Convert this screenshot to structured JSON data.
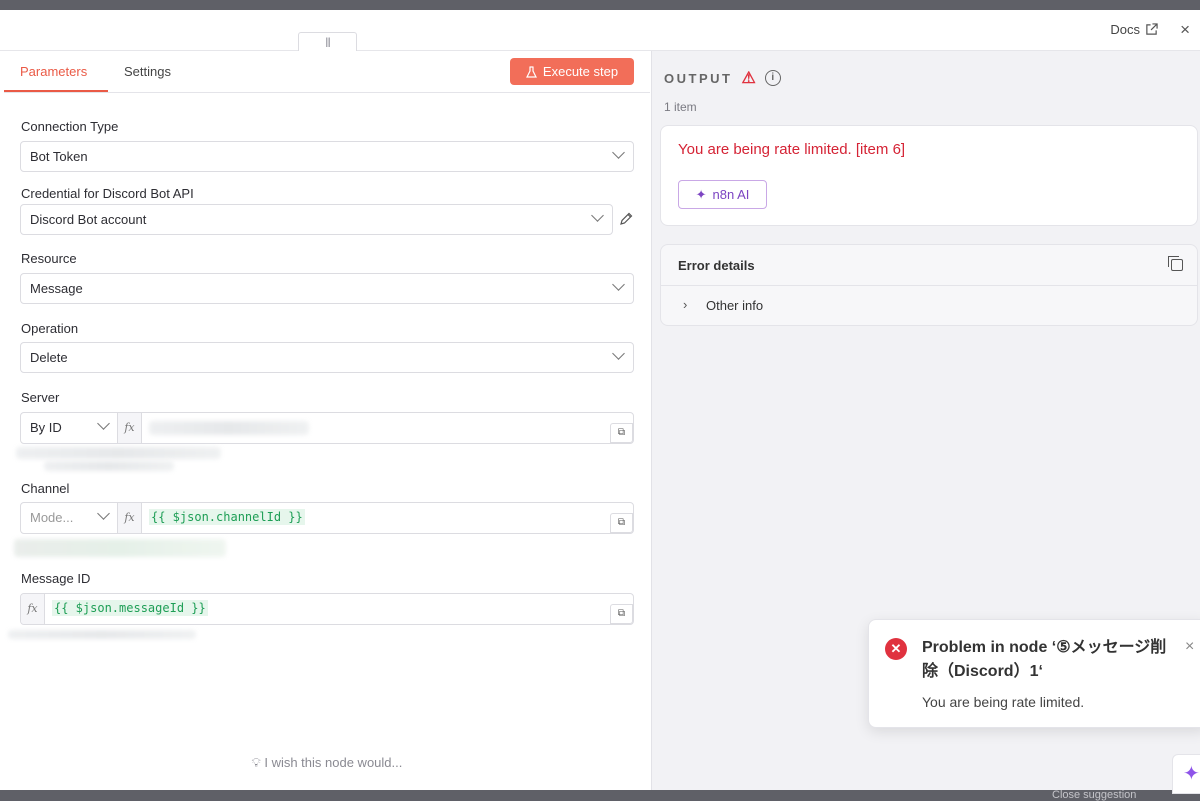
{
  "topbar": {
    "drag_handle": "|||",
    "docs_label": "Docs",
    "docs_icon": "external-link-icon",
    "close_symbol": "×"
  },
  "tabs": [
    {
      "label": "Parameters",
      "active": true
    },
    {
      "label": "Settings",
      "active": false
    }
  ],
  "execute_button": {
    "label": "Execute step",
    "icon": "flask-icon",
    "color": "#f26e59"
  },
  "form": {
    "connection_type": {
      "label": "Connection Type",
      "value": "Bot Token"
    },
    "credential": {
      "label": "Credential for Discord Bot API",
      "value": "Discord Bot account"
    },
    "resource": {
      "label": "Resource",
      "value": "Message"
    },
    "operation": {
      "label": "Operation",
      "value": "Delete"
    },
    "server": {
      "label": "Server",
      "mode": "By ID",
      "fx": "fx"
    },
    "channel": {
      "label": "Channel",
      "mode_placeholder": "Mode...",
      "fx": "fx",
      "expression": "{{ $json.channelId }}"
    },
    "message_id": {
      "label": "Message ID",
      "fx": "fx",
      "expression": "{{ $json.messageId }}"
    }
  },
  "wish_text": "I wish this node would...",
  "output": {
    "title": "OUTPUT",
    "item_count": "1 item",
    "error_message": "You are being rate limited. [item 6]",
    "ai_button": "n8n AI",
    "error_details_title": "Error details",
    "other_info_label": "Other info",
    "error_color": "#d52335"
  },
  "toast": {
    "title": "Problem in node ‘⑤メッセージ削除（Discord）1‘",
    "message": "You are being rate limited.",
    "close_symbol": "×"
  },
  "bottom_ghost_text": "Close suggestion"
}
